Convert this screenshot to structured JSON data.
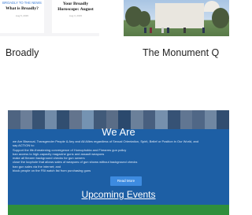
{
  "cards": [
    {
      "caption": "Broadly",
      "thumbnail": {
        "left_card": {
          "link": "BROADLY TO THE NEWS",
          "title": "What is Broadly?",
          "date": "Aug 5, 2015"
        },
        "right_card": {
          "title": "Your Broadly Horoscope: August",
          "date": "Aug 3, 2015"
        }
      }
    },
    {
      "caption": "The Monument Q",
      "thumbnail": {
        "description_icon": "capitol-building-photo"
      }
    }
  ],
  "banner": {
    "title": "We Are",
    "body": [
      "we Are Bisexual, Transgender People & Any and All Allies regardless of Sexual Orientation, Spirit, Belief or Position in Our World, and",
      "say ACTION to:",
      "Support the life-threatening convergence of Homophobia and Firearms gun policy",
      "ban access to high-capacity magazine guns and assault weapons",
      "make all firearm background checks for gun owners",
      "close the loophole that allows sales of weapons of gun shows without background checks",
      "ban gun sales via the internet; and",
      "block people on the FBI watch list from purchasing guns"
    ],
    "button_label": "Read More",
    "upcoming_events_label": "Upcoming Events",
    "colors": {
      "banner": "#1e5fa5",
      "button": "#3d8be0",
      "footer_strip": "#2f8f3c"
    }
  }
}
